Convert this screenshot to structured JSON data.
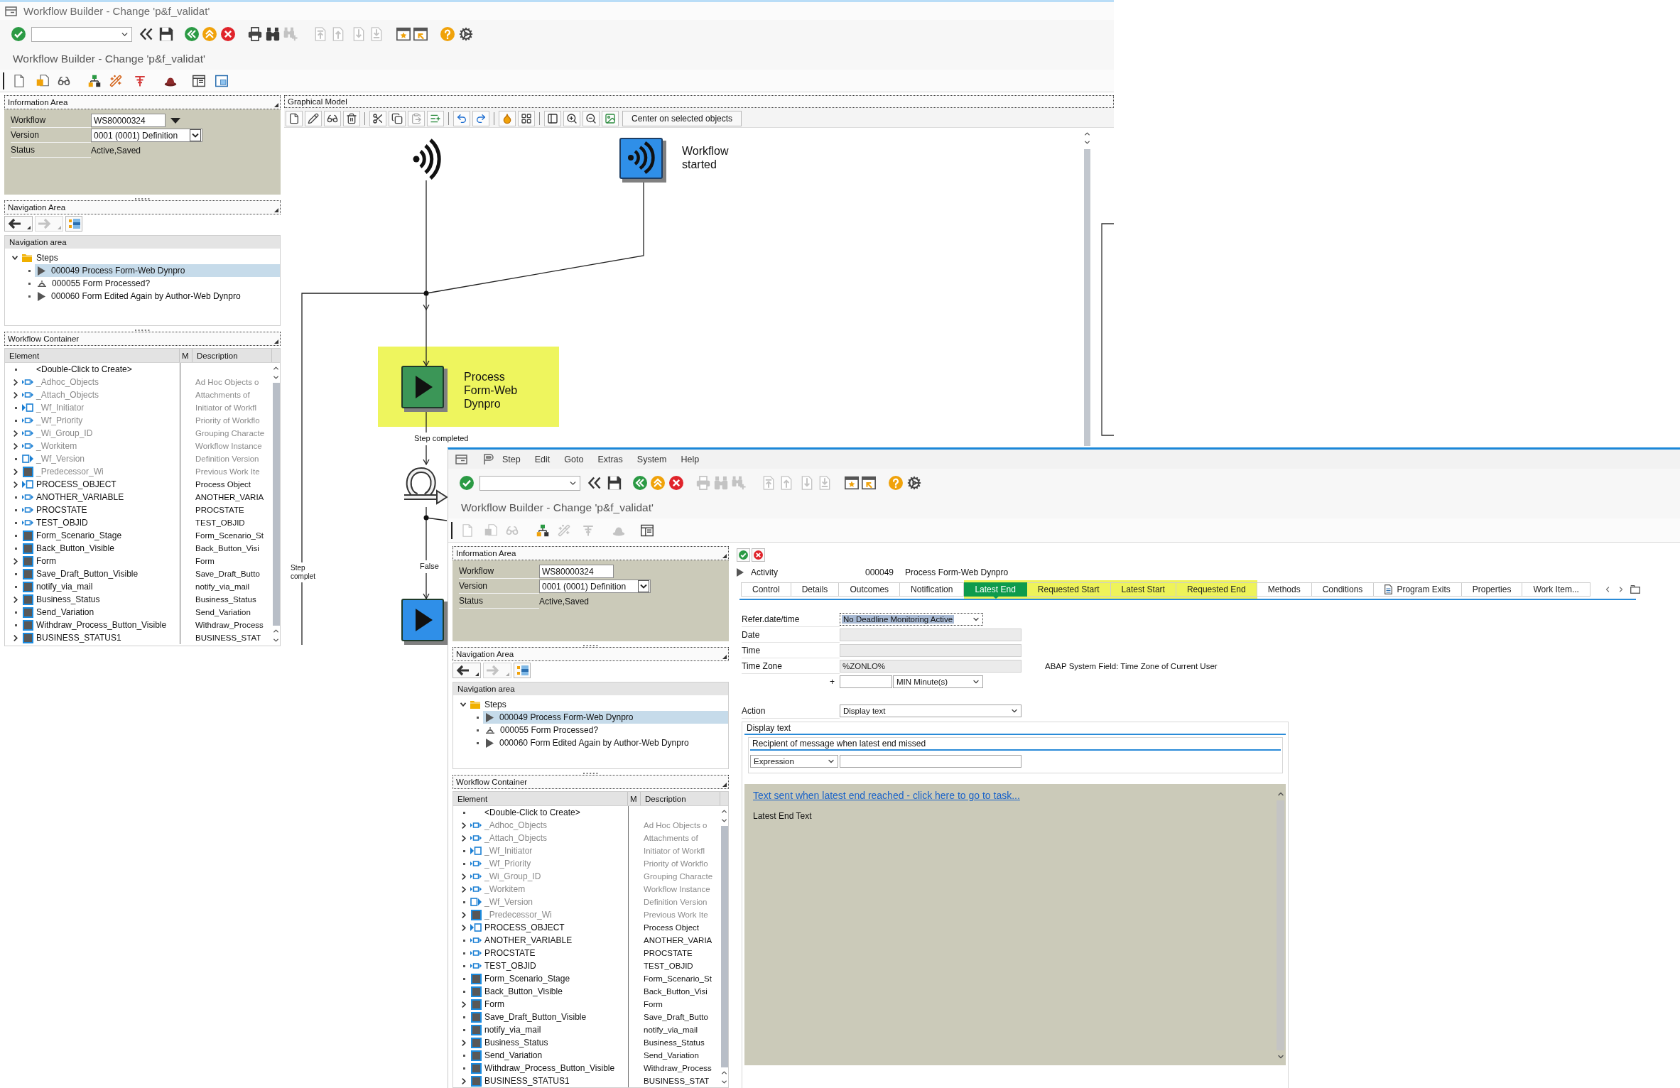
{
  "back_window": {
    "title": "Workflow Builder - Change 'p&f_validat'",
    "toolbar": [
      {
        "kind": "enter",
        "disabled": false
      },
      {
        "kind": "command-field",
        "disabled": false
      },
      {
        "kind": "back-chevrons",
        "disabled": false
      },
      {
        "kind": "save",
        "disabled": false
      },
      {
        "kind": "back",
        "disabled": false
      },
      {
        "kind": "exit",
        "disabled": false
      },
      {
        "kind": "cancel",
        "disabled": false
      },
      {
        "kind": "print",
        "disabled": false
      },
      {
        "kind": "find",
        "disabled": false
      },
      {
        "kind": "find-next",
        "disabled": true
      },
      {
        "kind": "first-page",
        "disabled": true
      },
      {
        "kind": "previous-page",
        "disabled": true
      },
      {
        "kind": "next-page",
        "disabled": true
      },
      {
        "kind": "last-page",
        "disabled": true
      },
      {
        "kind": "new-session",
        "disabled": false
      },
      {
        "kind": "shortcut",
        "disabled": false
      },
      {
        "kind": "help",
        "disabled": false
      },
      {
        "kind": "settings",
        "disabled": false
      }
    ],
    "screen_title": "Workflow Builder - Change 'p&f_validat'",
    "application_toolbar": [
      {
        "kind": "new",
        "disabled": false
      },
      {
        "kind": "insert",
        "disabled": false
      },
      {
        "kind": "display",
        "disabled": false
      },
      {
        "kind": "check",
        "disabled": false
      },
      {
        "kind": "activate",
        "disabled": false
      },
      {
        "kind": "test",
        "disabled": false
      },
      {
        "kind": "hat",
        "disabled": false
      },
      {
        "kind": "layout",
        "disabled": false
      },
      {
        "kind": "window-layout",
        "disabled": false
      }
    ],
    "info_area": {
      "title": "Information Area",
      "rows": [
        {
          "label": "Workflow",
          "value": "WS80000324",
          "kind": "input-menu"
        },
        {
          "label": "Version",
          "value": "0001 (0001) Definition",
          "kind": "dropdown"
        },
        {
          "label": "Status",
          "value": "Active,Saved",
          "kind": "text"
        }
      ]
    },
    "navigation_area": {
      "title": "Navigation Area",
      "buttons": [
        {
          "kind": "back",
          "disabled": false
        },
        {
          "kind": "forward",
          "disabled": true
        },
        {
          "kind": "overview",
          "disabled": false
        }
      ],
      "list_title": "Navigation area",
      "tree": [
        {
          "label": "Steps",
          "kind": "folder",
          "expanded": true,
          "selected": false,
          "children": [
            {
              "label": "000049 Process Form-Web Dynpro",
              "kind": "activity",
              "selected": true
            },
            {
              "label": "000055 Form Processed?",
              "kind": "condition",
              "selected": false
            },
            {
              "label": "000060 Form Edited Again by Author-Web Dynpro",
              "kind": "activity",
              "selected": false
            }
          ]
        }
      ]
    },
    "workflow_container": {
      "title": "Workflow Container",
      "columns": [
        "Element",
        "M",
        "Description"
      ],
      "rows": [
        {
          "element": "<Double-Click to Create>",
          "kind": "create",
          "expandable": false,
          "dimmed": false
        },
        {
          "element": "_Adhoc_Objects",
          "description": "Ad Hoc Objects o",
          "kind": "import-export",
          "expandable": true,
          "dimmed": true
        },
        {
          "element": "_Attach_Objects",
          "description": "Attachments of",
          "kind": "import-export",
          "expandable": true,
          "dimmed": true
        },
        {
          "element": "_Wf_Initiator",
          "description": "Initiator of Workfl",
          "kind": "import",
          "expandable": false,
          "dimmed": true
        },
        {
          "element": "_Wf_Priority",
          "description": "Priority of Workflo",
          "kind": "import-export",
          "expandable": false,
          "dimmed": true
        },
        {
          "element": "_Wi_Group_ID",
          "description": "Grouping Characte",
          "kind": "import-export",
          "expandable": true,
          "dimmed": true
        },
        {
          "element": "_Workitem",
          "description": "Workflow Instance",
          "kind": "import-export",
          "expandable": true,
          "dimmed": true
        },
        {
          "element": "_Wf_Version",
          "description": "Definition Version",
          "kind": "export",
          "expandable": false,
          "dimmed": true
        },
        {
          "element": "_Predecessor_Wi",
          "description": "Previous Work Ite",
          "kind": "local",
          "expandable": true,
          "dimmed": true
        },
        {
          "element": "PROCESS_OBJECT",
          "description": "Process Object",
          "kind": "import",
          "expandable": true,
          "dimmed": false
        },
        {
          "element": "ANOTHER_VARIABLE",
          "description": "ANOTHER_VARIA",
          "kind": "import-export",
          "expandable": false,
          "dimmed": false
        },
        {
          "element": "PROCSTATE",
          "description": "PROCSTATE",
          "kind": "import-export",
          "expandable": false,
          "dimmed": false
        },
        {
          "element": "TEST_OBJID",
          "description": "TEST_OBJID",
          "kind": "import-export",
          "expandable": false,
          "dimmed": false
        },
        {
          "element": "Form_Scenario_Stage",
          "description": "Form_Scenario_St",
          "kind": "local",
          "expandable": false,
          "dimmed": false
        },
        {
          "element": "Back_Button_Visible",
          "description": "Back_Button_Visi",
          "kind": "local",
          "expandable": false,
          "dimmed": false
        },
        {
          "element": "Form",
          "description": "Form",
          "kind": "local",
          "expandable": true,
          "dimmed": false
        },
        {
          "element": "Save_Draft_Button_Visible",
          "description": "Save_Draft_Butto",
          "kind": "local",
          "expandable": false,
          "dimmed": false
        },
        {
          "element": "notify_via_mail",
          "description": "notify_via_mail",
          "kind": "local",
          "expandable": false,
          "dimmed": false
        },
        {
          "element": "Business_Status",
          "description": "Business_Status",
          "kind": "local",
          "expandable": true,
          "dimmed": false
        },
        {
          "element": "Send_Variation",
          "description": "Send_Variation",
          "kind": "local",
          "expandable": false,
          "dimmed": false
        },
        {
          "element": "Withdraw_Process_Button_Visible",
          "description": "Withdraw_Process",
          "kind": "local",
          "expandable": false,
          "dimmed": false
        },
        {
          "element": "BUSINESS_STATUS1",
          "description": "BUSINESS_STAT",
          "kind": "local",
          "expandable": true,
          "dimmed": false
        }
      ]
    },
    "graphical_model": {
      "title": "Graphical Model",
      "center_button": "Center on selected objects",
      "nodes": [
        {
          "kind": "event",
          "selected": false
        },
        {
          "kind": "event-tile",
          "label": "Workflow started",
          "color": "#2f8fe8",
          "selected": false
        },
        {
          "kind": "activity",
          "label": "Process Form-Web Dynpro",
          "color": "#3b9657",
          "selected": true
        },
        {
          "kind": "loop",
          "selected": false
        },
        {
          "kind": "activity",
          "color": "#2f8fe8",
          "selected": false
        }
      ],
      "edge_labels": [
        "Step completed",
        "False",
        "Step complet"
      ]
    }
  },
  "front_window": {
    "menu": [
      "Step",
      "Edit",
      "Goto",
      "Extras",
      "System",
      "Help"
    ],
    "toolbar": [
      {
        "kind": "enter",
        "disabled": false
      },
      {
        "kind": "command-field",
        "disabled": false
      },
      {
        "kind": "back-chevrons",
        "disabled": false
      },
      {
        "kind": "save",
        "disabled": false
      },
      {
        "kind": "back",
        "disabled": false
      },
      {
        "kind": "exit",
        "disabled": false
      },
      {
        "kind": "cancel",
        "disabled": false
      },
      {
        "kind": "print",
        "disabled": true
      },
      {
        "kind": "find",
        "disabled": true
      },
      {
        "kind": "find-next",
        "disabled": true
      },
      {
        "kind": "first-page",
        "disabled": true
      },
      {
        "kind": "previous-page",
        "disabled": true
      },
      {
        "kind": "next-page",
        "disabled": true
      },
      {
        "kind": "last-page",
        "disabled": true
      },
      {
        "kind": "new-session",
        "disabled": false
      },
      {
        "kind": "shortcut",
        "disabled": false
      },
      {
        "kind": "help",
        "disabled": false
      },
      {
        "kind": "settings",
        "disabled": false
      }
    ],
    "screen_title": "Workflow Builder - Change 'p&f_validat'",
    "application_toolbar": [
      {
        "kind": "new",
        "disabled": true
      },
      {
        "kind": "insert",
        "disabled": true
      },
      {
        "kind": "display",
        "disabled": true
      },
      {
        "kind": "check",
        "disabled": false
      },
      {
        "kind": "activate",
        "disabled": true
      },
      {
        "kind": "test",
        "disabled": true
      },
      {
        "kind": "hat",
        "disabled": true
      },
      {
        "kind": "layout",
        "disabled": false
      }
    ],
    "info_area": {
      "title": "Information Area",
      "rows": [
        {
          "label": "Workflow",
          "value": "WS80000324",
          "kind": "input"
        },
        {
          "label": "Version",
          "value": "0001 (0001) Definition",
          "kind": "dropdown"
        },
        {
          "label": "Status",
          "value": "Active,Saved",
          "kind": "text"
        }
      ]
    },
    "navigation_area": {
      "title": "Navigation Area",
      "buttons": [
        {
          "kind": "back",
          "disabled": false
        },
        {
          "kind": "forward",
          "disabled": true
        },
        {
          "kind": "overview",
          "disabled": false
        }
      ],
      "list_title": "Navigation area",
      "tree": [
        {
          "label": "Steps",
          "kind": "folder",
          "expanded": true,
          "selected": false,
          "children": [
            {
              "label": "000049 Process Form-Web Dynpro",
              "kind": "activity",
              "selected": true
            },
            {
              "label": "000055 Form Processed?",
              "kind": "condition",
              "selected": false
            },
            {
              "label": "000060 Form Edited Again by Author-Web Dynpro",
              "kind": "activity",
              "selected": false
            }
          ]
        }
      ]
    },
    "workflow_container": {
      "title": "Workflow Container",
      "columns": [
        "Element",
        "M",
        "Description"
      ],
      "rows": [
        {
          "element": "<Double-Click to Create>",
          "kind": "create",
          "expandable": false,
          "dimmed": false
        },
        {
          "element": "_Adhoc_Objects",
          "description": "Ad Hoc Objects o",
          "kind": "import-export",
          "expandable": true,
          "dimmed": true
        },
        {
          "element": "_Attach_Objects",
          "description": "Attachments of",
          "kind": "import-export",
          "expandable": true,
          "dimmed": true
        },
        {
          "element": "_Wf_Initiator",
          "description": "Initiator of Workfl",
          "kind": "import",
          "expandable": false,
          "dimmed": true
        },
        {
          "element": "_Wf_Priority",
          "description": "Priority of Workflo",
          "kind": "import-export",
          "expandable": false,
          "dimmed": true
        },
        {
          "element": "_Wi_Group_ID",
          "description": "Grouping Characte",
          "kind": "import-export",
          "expandable": true,
          "dimmed": true
        },
        {
          "element": "_Workitem",
          "description": "Workflow Instance",
          "kind": "import-export",
          "expandable": true,
          "dimmed": true
        },
        {
          "element": "_Wf_Version",
          "description": "Definition Version",
          "kind": "export",
          "expandable": false,
          "dimmed": true
        },
        {
          "element": "_Predecessor_Wi",
          "description": "Previous Work Ite",
          "kind": "local",
          "expandable": true,
          "dimmed": true
        },
        {
          "element": "PROCESS_OBJECT",
          "description": "Process Object",
          "kind": "import",
          "expandable": true,
          "dimmed": false
        },
        {
          "element": "ANOTHER_VARIABLE",
          "description": "ANOTHER_VARIA",
          "kind": "import-export",
          "expandable": false,
          "dimmed": false
        },
        {
          "element": "PROCSTATE",
          "description": "PROCSTATE",
          "kind": "import-export",
          "expandable": false,
          "dimmed": false
        },
        {
          "element": "TEST_OBJID",
          "description": "TEST_OBJID",
          "kind": "import-export",
          "expandable": false,
          "dimmed": false
        },
        {
          "element": "Form_Scenario_Stage",
          "description": "Form_Scenario_St",
          "kind": "local",
          "expandable": false,
          "dimmed": false
        },
        {
          "element": "Back_Button_Visible",
          "description": "Back_Button_Visi",
          "kind": "local",
          "expandable": false,
          "dimmed": false
        },
        {
          "element": "Form",
          "description": "Form",
          "kind": "local",
          "expandable": true,
          "dimmed": false
        },
        {
          "element": "Save_Draft_Button_Visible",
          "description": "Save_Draft_Butto",
          "kind": "local",
          "expandable": false,
          "dimmed": false
        },
        {
          "element": "notify_via_mail",
          "description": "notify_via_mail",
          "kind": "local",
          "expandable": false,
          "dimmed": false
        },
        {
          "element": "Business_Status",
          "description": "Business_Status",
          "kind": "local",
          "expandable": true,
          "dimmed": false
        },
        {
          "element": "Send_Variation",
          "description": "Send_Variation",
          "kind": "local",
          "expandable": false,
          "dimmed": false
        },
        {
          "element": "Withdraw_Process_Button_Visible",
          "description": "Withdraw_Process",
          "kind": "local",
          "expandable": false,
          "dimmed": false
        },
        {
          "element": "BUSINESS_STATUS1",
          "description": "BUSINESS_STAT",
          "kind": "local",
          "expandable": true,
          "dimmed": false
        }
      ]
    },
    "step_editor": {
      "activity": {
        "expanded": false,
        "label": "Activity",
        "number": "000049",
        "name": "Process Form-Web Dynpro"
      },
      "tabs": [
        {
          "label": "Control",
          "kind": "text",
          "selected": false,
          "highlighted": false
        },
        {
          "label": "Details",
          "kind": "text",
          "selected": false,
          "highlighted": false
        },
        {
          "label": "Outcomes",
          "kind": "text",
          "selected": false,
          "highlighted": false
        },
        {
          "label": "Notification",
          "kind": "text",
          "selected": false,
          "highlighted": false
        },
        {
          "label": "Latest End",
          "kind": "text",
          "selected": true,
          "highlighted": true
        },
        {
          "label": "Requested Start",
          "kind": "text",
          "selected": false,
          "highlighted": true
        },
        {
          "label": "Latest Start",
          "kind": "text",
          "selected": false,
          "highlighted": true
        },
        {
          "label": "Requested End",
          "kind": "text",
          "selected": false,
          "highlighted": true
        },
        {
          "label": "Methods",
          "kind": "text",
          "selected": false,
          "highlighted": false
        },
        {
          "label": "Conditions",
          "kind": "text",
          "selected": false,
          "highlighted": false
        },
        {
          "label": "Program Exits",
          "kind": "icon-text",
          "selected": false,
          "highlighted": false
        },
        {
          "label": "Properties",
          "kind": "text",
          "selected": false,
          "highlighted": false
        },
        {
          "label": "Work Item...",
          "kind": "text",
          "selected": false,
          "highlighted": false
        }
      ],
      "deadline_fields": [
        {
          "kind": "dropdown",
          "label": "Refer.date/time",
          "value": "No Deadline Monitoring Active",
          "disabled": false,
          "focused": true
        },
        {
          "kind": "input",
          "label": "Date",
          "disabled": true,
          "focused": false
        },
        {
          "kind": "input",
          "label": "Time",
          "disabled": true,
          "focused": false
        },
        {
          "kind": "input",
          "label": "Time Zone",
          "value": "%ZONLO%",
          "disabled": true,
          "focused": false,
          "note": "ABAP System Field: Time Zone of Current User"
        }
      ],
      "offset": {
        "sign": "+",
        "unit": "MIN Minute(s)"
      },
      "action": {
        "label": "Action",
        "value": "Display text"
      },
      "display_group": {
        "title": "Display text",
        "recipient": {
          "title": "Recipient of message when latest end missed",
          "type": "Expression"
        },
        "text_link": "Text sent when latest end reached - click here to go to task...",
        "text": "Latest End Text"
      }
    }
  }
}
